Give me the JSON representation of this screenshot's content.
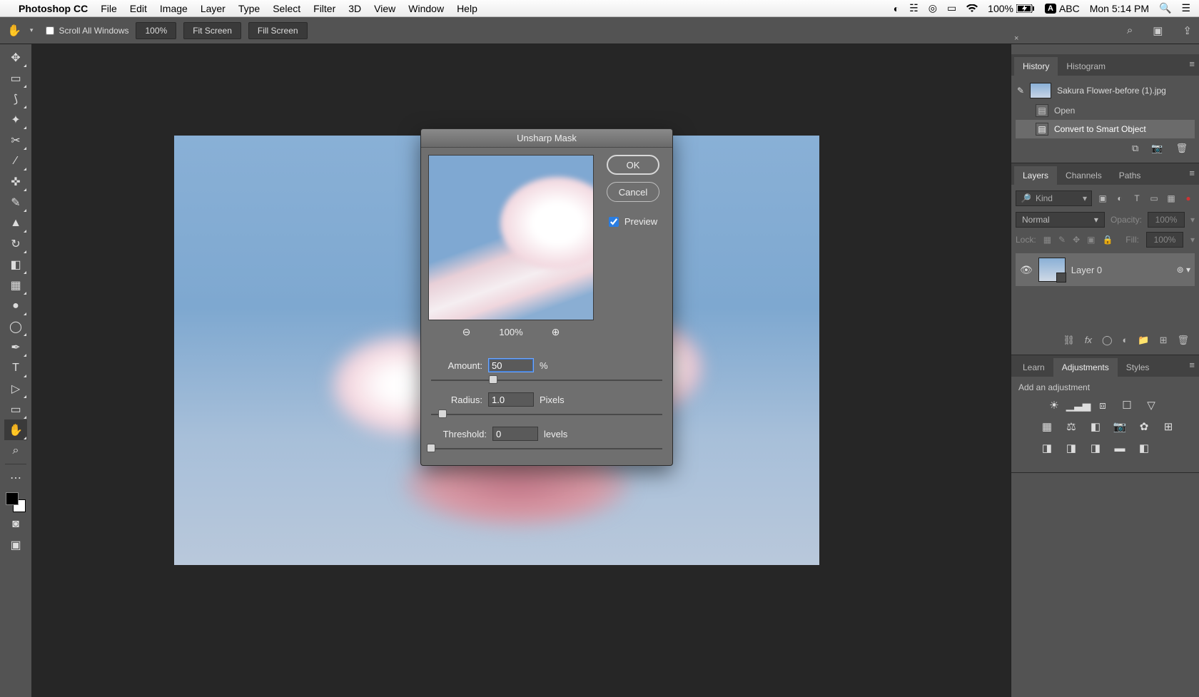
{
  "mac_menu": {
    "app": "Photoshop CC",
    "items": [
      "File",
      "Edit",
      "Image",
      "Layer",
      "Type",
      "Select",
      "Filter",
      "3D",
      "View",
      "Window",
      "Help"
    ],
    "battery": "100%",
    "ime": "ABC",
    "clock": "Mon 5:14 PM"
  },
  "options_bar": {
    "scroll_all": "Scroll All Windows",
    "zoom": "100%",
    "fit": "Fit Screen",
    "fill": "Fill Screen"
  },
  "dialog": {
    "title": "Unsharp Mask",
    "ok": "OK",
    "cancel": "Cancel",
    "preview_label": "Preview",
    "preview_checked": true,
    "zoom": "100%",
    "amount_label": "Amount:",
    "amount_value": "50",
    "amount_unit": "%",
    "amount_pos_pct": 27,
    "radius_label": "Radius:",
    "radius_value": "1.0",
    "radius_unit": "Pixels",
    "radius_pos_pct": 5,
    "threshold_label": "Threshold:",
    "threshold_value": "0",
    "threshold_unit": "levels",
    "threshold_pos_pct": 0
  },
  "panels": {
    "history": {
      "tabs": [
        "History",
        "Histogram"
      ],
      "doc_name": "Sakura Flower-before (1).jpg",
      "steps": [
        "Open",
        "Convert to Smart Object"
      ]
    },
    "layers": {
      "tabs": [
        "Layers",
        "Channels",
        "Paths"
      ],
      "kind_placeholder": "Kind",
      "blend_mode": "Normal",
      "opacity_label": "Opacity:",
      "opacity_value": "100%",
      "lock_label": "Lock:",
      "fill_label": "Fill:",
      "fill_value": "100%",
      "layer0": "Layer 0"
    },
    "adjust": {
      "tabs": [
        "Learn",
        "Adjustments",
        "Styles"
      ],
      "heading": "Add an adjustment"
    }
  }
}
